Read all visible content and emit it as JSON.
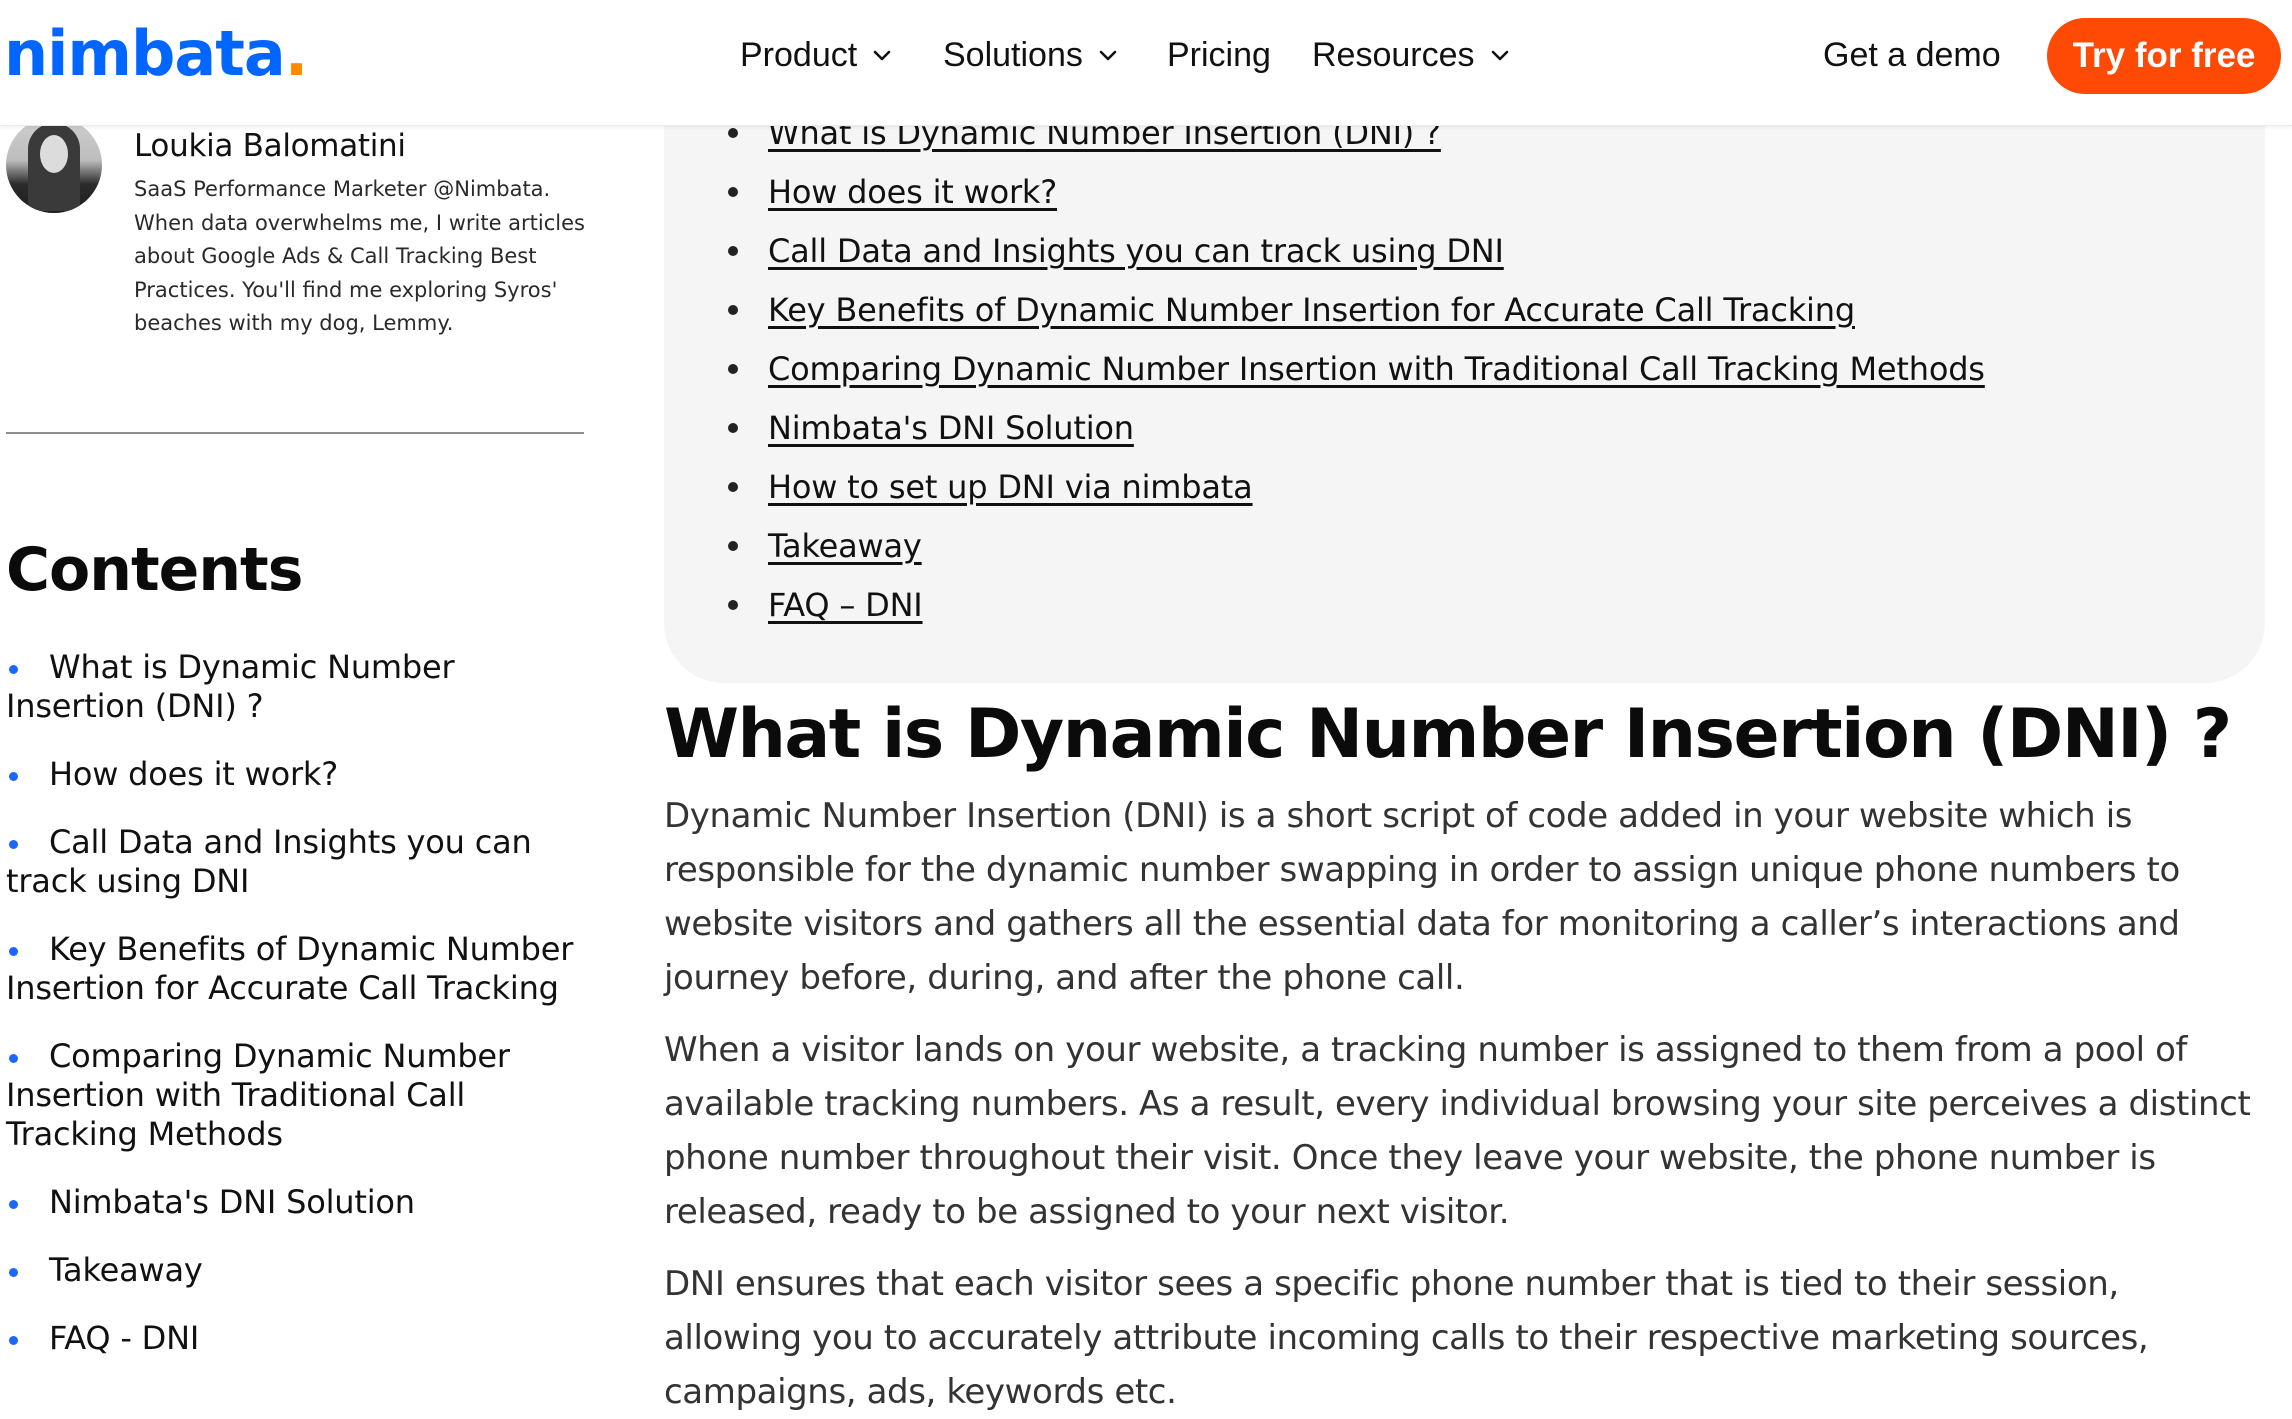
{
  "header": {
    "logo_text": "nimbata",
    "logo_dot": ".",
    "nav": [
      {
        "label": "Product",
        "has_dropdown": true
      },
      {
        "label": "Solutions",
        "has_dropdown": true
      },
      {
        "label": "Pricing",
        "has_dropdown": false
      },
      {
        "label": "Resources",
        "has_dropdown": true
      }
    ],
    "get_demo_label": "Get a demo",
    "try_free_label": "Try for free"
  },
  "colors": {
    "brand_blue": "#0066ff",
    "brand_orange_dot": "#ff8a00",
    "cta_orange": "#ff4a05",
    "toc_card_bg": "#f5f5f5",
    "sidebar_bullet": "#1a66ff"
  },
  "author": {
    "name": "Loukia Balomatini",
    "bio": "SaaS Performance Marketer @Nimbata. When data overwhelms me, I write articles about Google Ads & Call Tracking Best Practices. You'll find me exploring Syros' beaches with my dog, Lemmy."
  },
  "sidebar": {
    "contents_title": "Contents",
    "toc": [
      "What is Dynamic Number Insertion (DNI) ?",
      "How does it work?",
      "Call Data and Insights you can track using DNI",
      "Key Benefits of Dynamic Number Insertion for Accurate Call Tracking",
      "Comparing Dynamic Number Insertion with Traditional Call Tracking Methods",
      "Nimbata's DNI Solution",
      "Takeaway",
      "FAQ - DNI"
    ]
  },
  "main": {
    "toc_links": [
      "What is Dynamic Number Insertion (DNI) ?",
      "How does it work?",
      "Call Data and Insights you can track using DNI",
      "Key Benefits of Dynamic Number Insertion for Accurate Call Tracking",
      "Comparing Dynamic Number Insertion with Traditional Call Tracking Methods",
      "Nimbata's DNI Solution",
      "How to set up DNI via nimbata",
      "Takeaway",
      "FAQ – DNI"
    ],
    "heading": "What is Dynamic Number Insertion (DNI) ?",
    "paragraphs": [
      "Dynamic Number Insertion (DNI) is a short script of code added in your website which is responsible for the dynamic number swapping in order to assign unique phone numbers to website visitors and gathers all the essential data for monitoring a caller’s interactions and journey before, during, and after the phone call.",
      "When a visitor lands on your website, a tracking number is assigned to them from a pool of available tracking numbers. As a result, every individual browsing your site perceives a distinct phone number throughout their visit. Once they leave your website, the phone number is released, ready to be assigned to your next visitor.",
      "DNI ensures that each visitor sees a specific phone number that is tied to their session, allowing you to accurately attribute incoming calls to their respective marketing sources, campaigns, ads, keywords etc."
    ]
  }
}
